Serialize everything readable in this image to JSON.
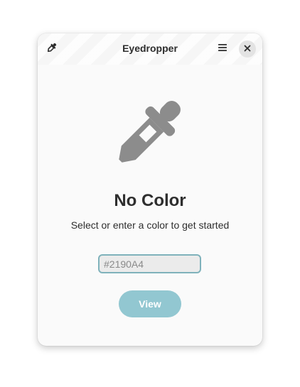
{
  "window": {
    "title": "Eyedropper"
  },
  "headerbar": {
    "picker_icon": "eyedropper-icon",
    "menu_icon": "hamburger-menu-icon",
    "close_icon": "close-icon"
  },
  "main": {
    "hero_icon": "eyedropper-icon",
    "heading": "No Color",
    "subtitle": "Select or enter a color to get started",
    "color_input": {
      "value": "",
      "placeholder": "#2190A4"
    },
    "view_button_label": "View"
  },
  "colors": {
    "window_bg": "#fafafa",
    "text": "#2e2e2e",
    "icon_gray": "#8c8c8c",
    "accent": "#92c7d1",
    "input_border": "#7fb2bb"
  }
}
